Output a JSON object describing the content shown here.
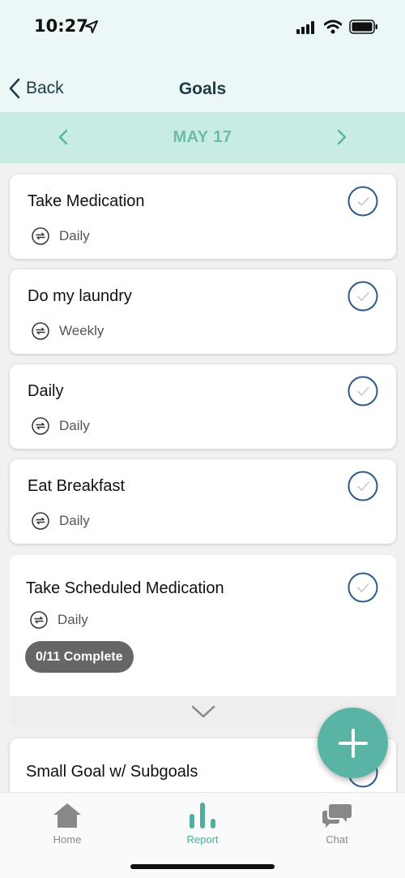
{
  "status_bar": {
    "time": "10:27"
  },
  "nav": {
    "back_label": "Back",
    "title": "Goals"
  },
  "date_bar": {
    "date": "MAY 17"
  },
  "goals": [
    {
      "title": "Take Medication",
      "frequency": "Daily"
    },
    {
      "title": "Do my laundry",
      "frequency": "Weekly"
    },
    {
      "title": "Daily",
      "frequency": "Daily"
    },
    {
      "title": "Eat Breakfast",
      "frequency": "Daily"
    },
    {
      "title": "Take Scheduled Medication",
      "frequency": "Daily",
      "progress": "0/11 Complete"
    },
    {
      "title": "Small Goal w/ Subgoals"
    }
  ],
  "tabs": [
    {
      "label": "Home",
      "icon": "home-icon"
    },
    {
      "label": "Report",
      "icon": "bar-chart-icon",
      "active": true
    },
    {
      "label": "Chat",
      "icon": "chat-bubbles-icon"
    }
  ],
  "colors": {
    "accent": "#5ab4a5",
    "header_bg": "#ecf7f7",
    "date_bar_bg": "#c8ebe4",
    "check_ring": "#2b5a8c"
  }
}
